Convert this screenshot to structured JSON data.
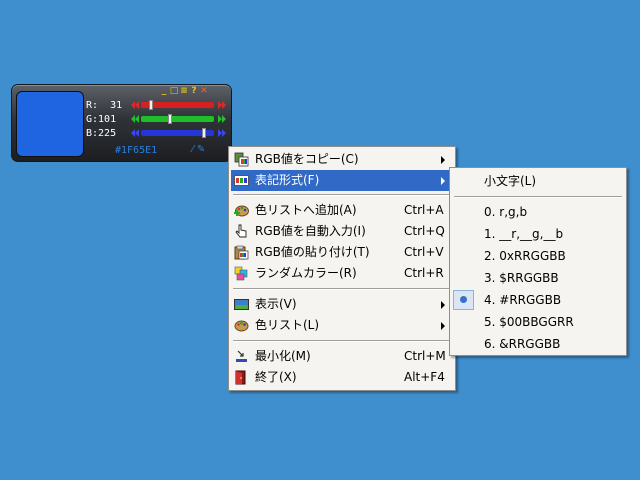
{
  "colors": {
    "swatch": "#1F65E1",
    "desktop": "#3f8ecd",
    "highlight": "#3169c6",
    "red_track": "#d62020",
    "green_track": "#1fbf2a",
    "blue_track": "#2436d8"
  },
  "widget": {
    "hex": "#1F65E1",
    "channels": [
      {
        "label": "R:  31",
        "value": 31,
        "max": 255
      },
      {
        "label": "G:101",
        "value": 101,
        "max": 255
      },
      {
        "label": "B:225",
        "value": 225,
        "max": 255
      }
    ],
    "title_buttons": [
      "minimize-icon",
      "maximize-icon",
      "options-icon",
      "help-icon",
      "close-icon"
    ],
    "tools": [
      "eyedropper-icon",
      "picker-icon"
    ]
  },
  "menu": {
    "items": [
      {
        "label": "RGB値をコピー(C)",
        "shortcut": "",
        "submenu": true,
        "icon": "copy-rgb-icon"
      },
      {
        "label": "表記形式(F)",
        "shortcut": "",
        "submenu": true,
        "icon": "format-icon",
        "highlighted": true
      },
      {
        "label": "色リストへ追加(A)",
        "shortcut": "Ctrl+A",
        "icon": "add-color-icon"
      },
      {
        "label": "RGB値を自動入力(I)",
        "shortcut": "Ctrl+Q",
        "icon": "auto-input-icon"
      },
      {
        "label": "RGB値の貼り付け(T)",
        "shortcut": "Ctrl+V",
        "icon": "paste-rgb-icon"
      },
      {
        "label": "ランダムカラー(R)",
        "shortcut": "Ctrl+R",
        "icon": "random-color-icon"
      },
      {
        "label": "表示(V)",
        "shortcut": "",
        "submenu": true,
        "icon": "view-icon"
      },
      {
        "label": "色リスト(L)",
        "shortcut": "",
        "submenu": true,
        "icon": "color-list-icon"
      },
      {
        "label": "最小化(M)",
        "shortcut": "Ctrl+M",
        "icon": "minimize-window-icon"
      },
      {
        "label": "終了(X)",
        "shortcut": "Alt+F4",
        "icon": "exit-icon"
      }
    ]
  },
  "submenu": {
    "items": [
      {
        "label": "小文字(L)"
      },
      {
        "label": "0. r,g,b"
      },
      {
        "label": "1. __r,__g,__b"
      },
      {
        "label": "2. 0xRRGGBB"
      },
      {
        "label": "3. $RRGGBB"
      },
      {
        "label": "4. #RRGGBB",
        "selected": true
      },
      {
        "label": "5. $00BBGGRR"
      },
      {
        "label": "6. &RRGGBB"
      }
    ]
  }
}
